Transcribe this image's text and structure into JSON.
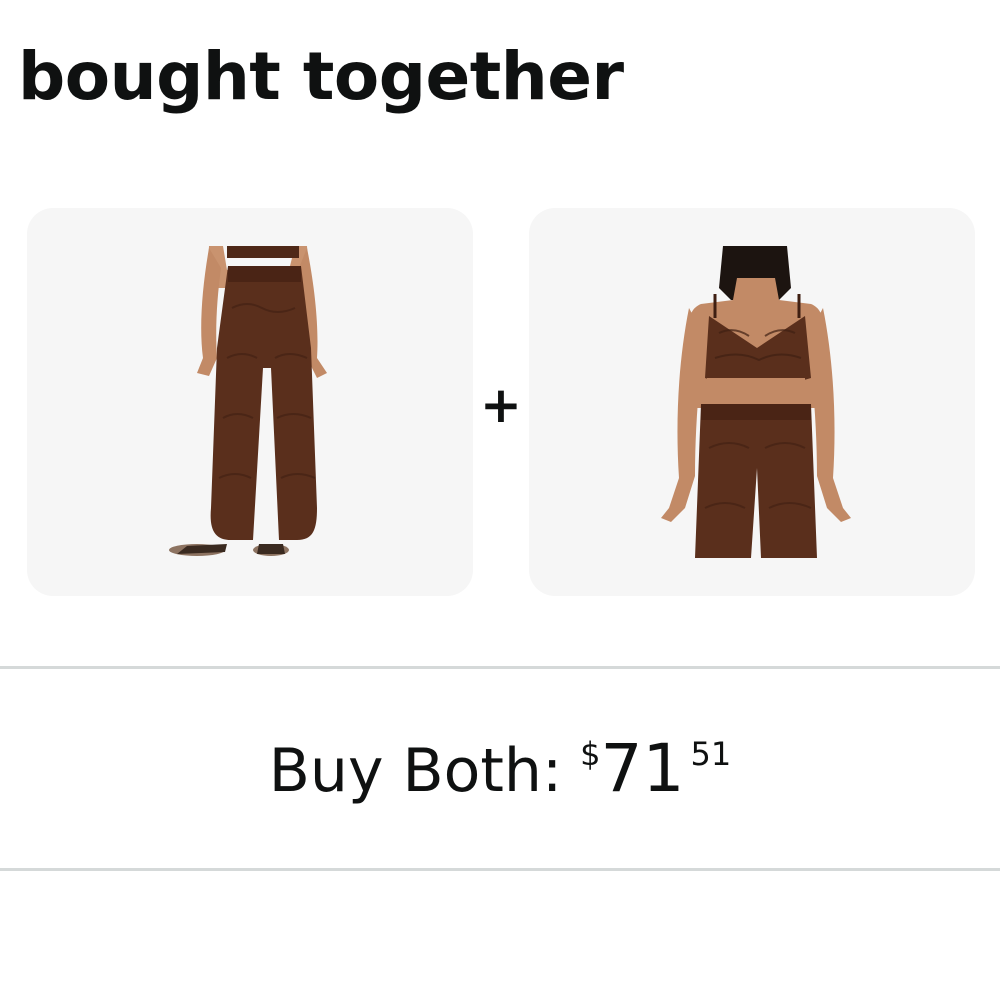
{
  "section": {
    "title": "bought together"
  },
  "products": [
    {
      "image_icon": "brown-knit-wide-leg-pants-image"
    },
    {
      "image_icon": "brown-knit-cami-crop-top-image"
    }
  ],
  "separator": "+",
  "buy_both": {
    "label": "Buy Both:",
    "price_symbol": "$",
    "price_whole": "71",
    "price_fraction": "51"
  },
  "colors": {
    "text": "#0f1111",
    "card_background": "#f6f6f6",
    "divider": "#d5d9d9",
    "garment_brown": "#5a2f1c"
  }
}
